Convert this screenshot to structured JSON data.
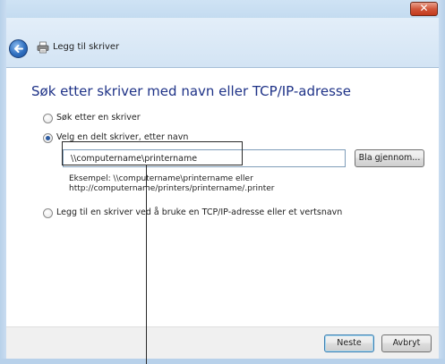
{
  "window": {
    "title": "Legg til skriver",
    "close_glyph": "✕"
  },
  "icons": {
    "back": "back-arrow-icon",
    "printer": "printer-icon",
    "close": "close-icon"
  },
  "heading": "Søk etter skriver med navn eller TCP/IP-adresse",
  "options": [
    {
      "label": "Søk etter en skriver",
      "checked": false
    },
    {
      "label": "Velg en delt skriver, etter navn",
      "checked": true
    },
    {
      "label": "Legg til en skriver ved å bruke en TCP/IP-adresse eller et vertsnavn",
      "checked": false
    }
  ],
  "share_input": {
    "value": "\\\\computername\\printername"
  },
  "browse_button": "Bla gjennom...",
  "example": {
    "line1": "Eksempel: \\\\computername\\printername eller",
    "line2": "http://computername/printers/printername/.printer"
  },
  "footer": {
    "next_button": "Neste",
    "cancel_button": "Avbryt"
  },
  "colors": {
    "heading": "#1e3287",
    "frame": "#b8d1ea",
    "close": "#c2391c"
  }
}
